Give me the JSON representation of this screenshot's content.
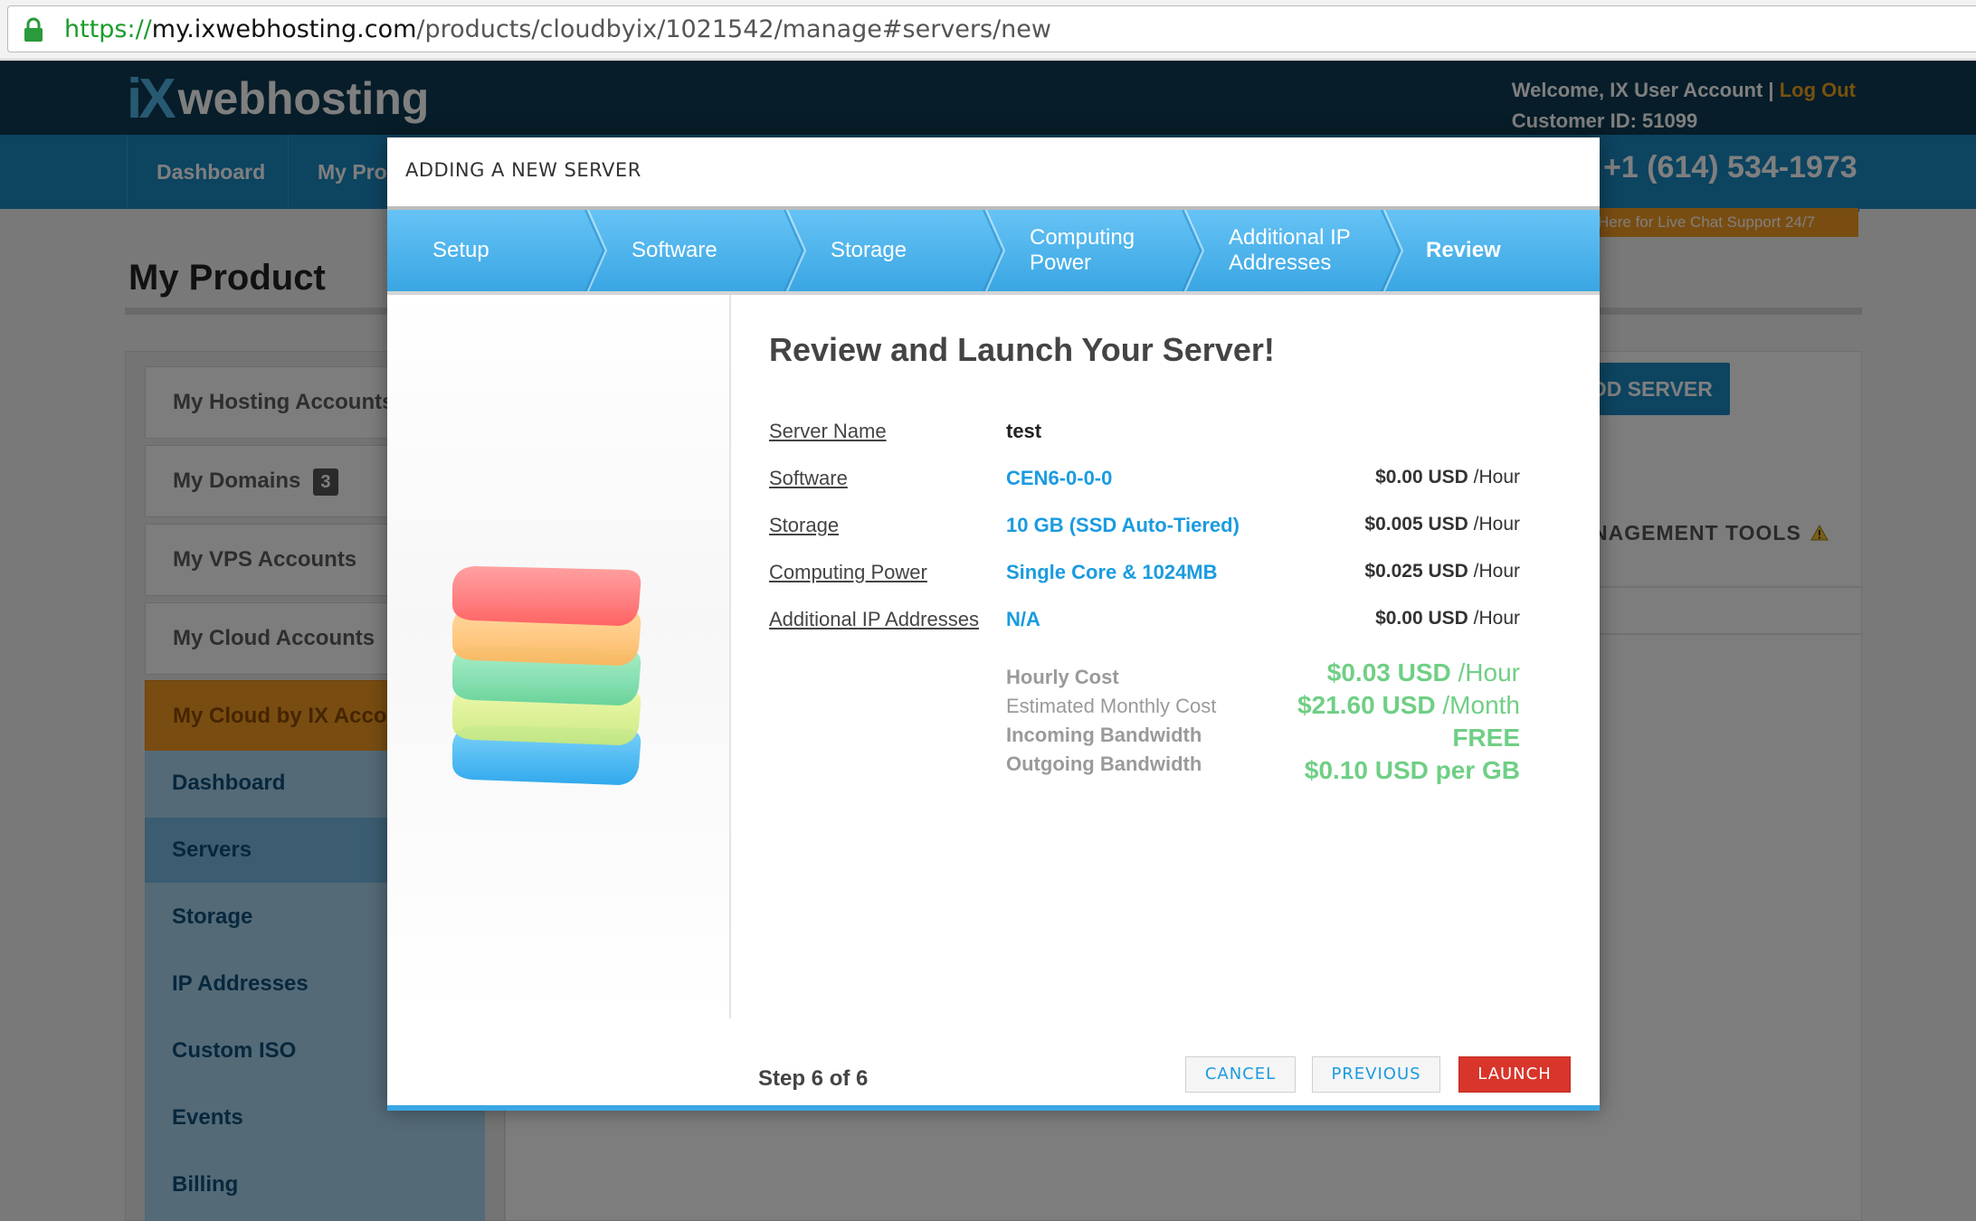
{
  "browser": {
    "url_scheme": "https://",
    "url_host": "my.ixwebhosting.com",
    "url_path": "/products/cloudbyix/1021542/manage#servers/new"
  },
  "site": {
    "logo_ix": "iX",
    "logo_word": "webhosting",
    "welcome": "Welcome, IX User Account | ",
    "logout": "Log Out",
    "customer_id": "Customer ID: 51099",
    "nav": [
      "Dashboard",
      "My Pro"
    ],
    "phone": "+1 (614) 534-1973",
    "chat": "Here for Live Chat Support 24/7",
    "page_title": "My Product",
    "sidebar": [
      {
        "label": "My Hosting Accounts"
      },
      {
        "label": "My Domains",
        "badge": "3"
      },
      {
        "label": "My VPS Accounts"
      },
      {
        "label": "My Cloud Accounts"
      },
      {
        "label": "My Cloud by IX Acco"
      }
    ],
    "subnav": [
      "Dashboard",
      "Servers",
      "Storage",
      "IP Addresses",
      "Custom ISO",
      "Events",
      "Billing"
    ],
    "add_server": "DD SERVER",
    "mgmt_tools": "NAGEMENT TOOLS"
  },
  "modal": {
    "title": "ADDING A NEW SERVER",
    "steps": [
      {
        "line1": "Setup",
        "line2": ""
      },
      {
        "line1": "Software",
        "line2": ""
      },
      {
        "line1": "Storage",
        "line2": ""
      },
      {
        "line1": "Computing",
        "line2": "Power"
      },
      {
        "line1": "Additional IP",
        "line2": "Addresses"
      },
      {
        "line1": "Review",
        "line2": ""
      }
    ],
    "active_step": "Review",
    "review_title": "Review and Launch Your Server!",
    "rows": [
      {
        "label": "Server Name",
        "value": "test",
        "amount": "",
        "unit": ""
      },
      {
        "label": "Software",
        "value": "CEN6-0-0-0",
        "amount": "$0.00 USD",
        "unit": " /Hour"
      },
      {
        "label": "Storage",
        "value": "10 GB (SSD Auto-Tiered)",
        "amount": "$0.005 USD",
        "unit": " /Hour"
      },
      {
        "label": "Computing Power",
        "value": "Single Core & 1024MB",
        "amount": "$0.025 USD",
        "unit": " /Hour"
      },
      {
        "label": "Additional IP Addresses",
        "value": "N/A",
        "amount": "$0.00 USD",
        "unit": " /Hour"
      }
    ],
    "summary": [
      {
        "label": "Hourly Cost",
        "amount": "$0.03 USD",
        "unit": " /Hour"
      },
      {
        "label": "Estimated Monthly Cost",
        "amount": "$21.60 USD",
        "unit": " /Month"
      },
      {
        "label": "Incoming Bandwidth",
        "amount": "FREE",
        "unit": ""
      },
      {
        "label": "Outgoing Bandwidth",
        "amount": "$0.10 USD per GB",
        "unit": ""
      }
    ],
    "step_of": "Step 6 of 6",
    "cancel": "CANCEL",
    "previous": "PREVIOUS",
    "launch": "LAUNCH"
  },
  "colors": {
    "accent_blue": "#1a9be0",
    "launch_red": "#d8352b",
    "summary_green": "#6fcf85",
    "header_navy": "#0f3b52"
  }
}
